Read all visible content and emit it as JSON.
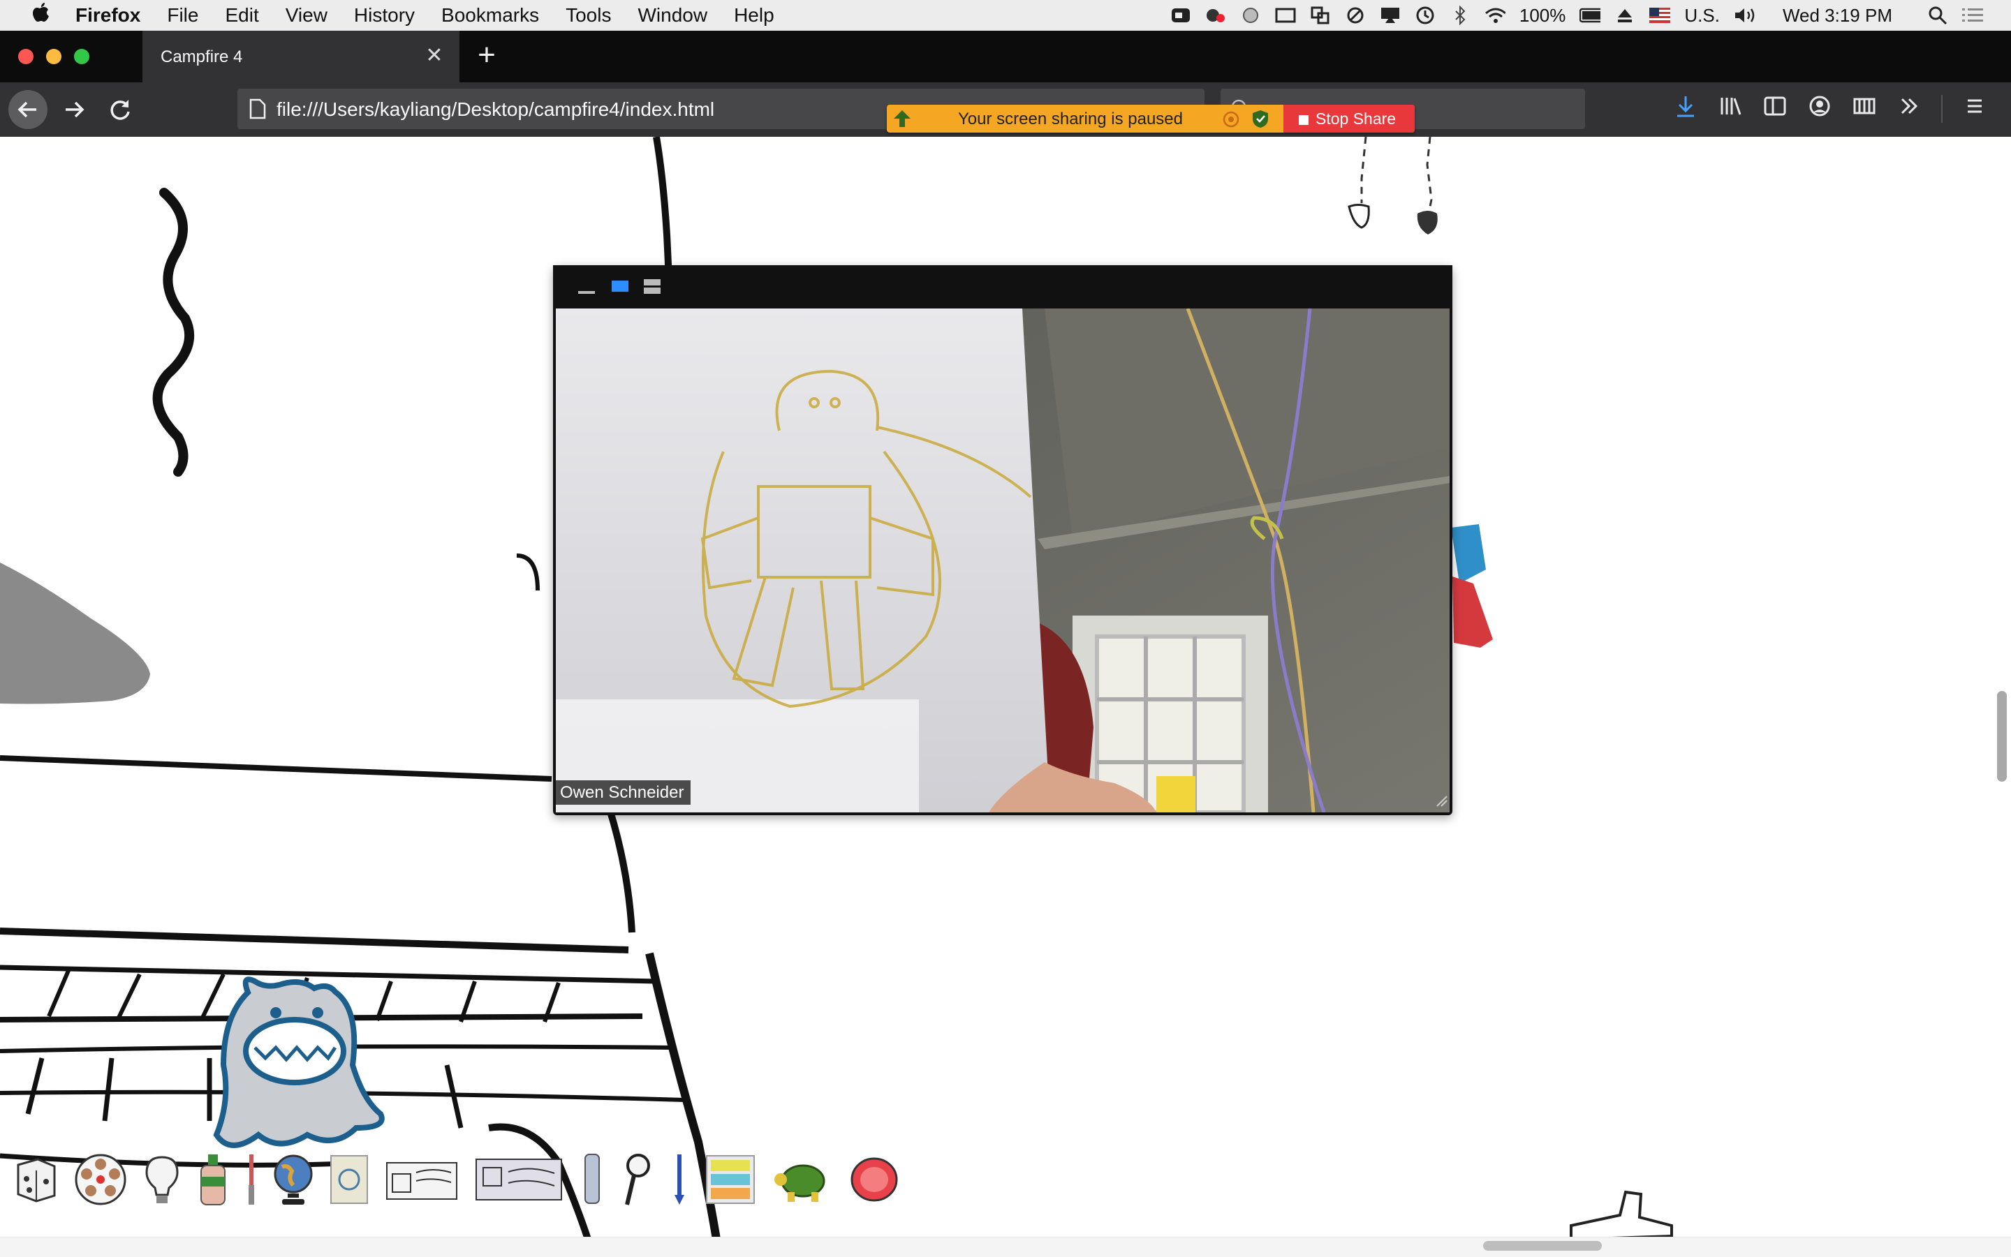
{
  "menubar": {
    "app_name": "Firefox",
    "items": [
      "File",
      "Edit",
      "View",
      "History",
      "Bookmarks",
      "Tools",
      "Window",
      "Help"
    ],
    "battery": "100%",
    "input_source": "U.S.",
    "clock": "Wed 3:19 PM"
  },
  "browser": {
    "tab_title": "Campfire 4",
    "url": "file:///Users/kayliang/Desktop/campfire4/index.html"
  },
  "share_notice": {
    "message": "Your screen sharing is paused",
    "stop_label": "Stop Share"
  },
  "video": {
    "participant_name": "Owen Schneider"
  },
  "tray_items": [
    "dice-icon",
    "photo-wheel-icon",
    "lightbulb-icon",
    "bottle-icon",
    "brush-icon",
    "globe-icon",
    "passport-icon",
    "student-card-icon",
    "badge-card-icon",
    "tube-icon",
    "magnifier-icon",
    "pen-icon",
    "sticky-notes-icon",
    "turtle-icon",
    "fruit-icon"
  ],
  "colors": {
    "share_notice": "#f5a623",
    "stop_share": "#e8383b",
    "browser_chrome": "#323234"
  }
}
